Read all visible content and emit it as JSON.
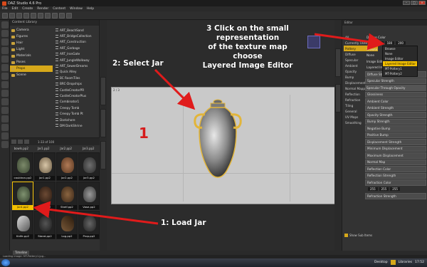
{
  "window": {
    "title": "DAZ Studio 4.6 Pro",
    "controls": [
      "–",
      "□",
      "×"
    ]
  },
  "menu": [
    "File",
    "Edit",
    "Create",
    "Render",
    "Content",
    "Window",
    "Help"
  ],
  "content_library": {
    "header": "Content Library",
    "tree": [
      "Camera",
      "Figures",
      "Hair",
      "Light",
      "Materials",
      "Poses",
      "Props",
      "Scene"
    ],
    "selected": "Props",
    "list": [
      "ART_BeachSand",
      "ART_BridgeCollection",
      "ART_Construction",
      "ART_Garbage",
      "ART_IronGate",
      "ART_JungleWalkway",
      "ART_SewerDreams",
      "Quick Alley",
      "BC RoomTiles",
      "BRC-Dropships",
      "CastleCreatorPR",
      "CastleCreatorPlus",
      "Combinator1",
      "Creepy Tomb",
      "Creepy Tomb Pt",
      "Darkshore",
      "DM DarkShrine"
    ]
  },
  "thumbnails": {
    "count": "1-33 of 100",
    "top_labels": [
      "bowls.pp2",
      "Jar1.pp2",
      "Jar2.pp2",
      "Jar3.pp2"
    ],
    "items": [
      {
        "label": "cauldron.pp2",
        "selected": false
      },
      {
        "label": "Jar1.pp2",
        "selected": false
      },
      {
        "label": "Jar2.pp2",
        "selected": false
      },
      {
        "label": "Jar3.pp2",
        "selected": false
      },
      {
        "label": "Jar4.pp2",
        "selected": true
      },
      {
        "label": "rack.pp2",
        "selected": false
      },
      {
        "label": "Shelf.pp2",
        "selected": false
      },
      {
        "label": "Vase.pp2",
        "selected": false
      },
      {
        "label": "Knife.pp2",
        "selected": false
      },
      {
        "label": "Stand.pp2",
        "selected": false
      },
      {
        "label": "Log.pp2",
        "selected": false
      },
      {
        "label": "Prop.pp2",
        "selected": false
      }
    ],
    "tab": "Files"
  },
  "viewport": {
    "label": "2 / 3",
    "tab": "Timeline"
  },
  "surfaces": {
    "header": "Editor",
    "title": "Pottery",
    "scene_items": [
      "All",
      "Currently Used",
      "Pottery",
      "Diffuse",
      "Specular",
      "Ambient",
      "Opacity",
      "Bump",
      "Displacement",
      "Normal Mapping",
      "Reflection",
      "Refraction",
      "Tiling",
      "General",
      "UV Maps",
      "Smoothing"
    ],
    "selected_item": "Pottery",
    "groups": [
      "Diffuse",
      "Specular",
      "Ambient",
      "Opacity",
      "Bump",
      "Displacement",
      "Normal Mapping"
    ],
    "properties": [
      {
        "label": "Diffuse Color",
        "kind": "header"
      },
      {
        "label": "",
        "kind": "rgb",
        "values": [
          "150",
          "180",
          "200"
        ]
      },
      {
        "label": "Browse",
        "kind": "row"
      },
      {
        "label": "None",
        "kind": "row"
      },
      {
        "label": "Image Editor",
        "kind": "row"
      },
      {
        "label": "Layered Image Editor",
        "kind": "row"
      },
      {
        "label": "Diffuse Strength",
        "kind": "slider"
      },
      {
        "label": "Specular Strength",
        "kind": "slider"
      },
      {
        "label": "Specular Through Opacity",
        "kind": "dropdown"
      },
      {
        "label": "Glossiness",
        "kind": "slider"
      },
      {
        "label": "Ambient Color",
        "kind": "slider"
      },
      {
        "label": "Ambient Strength",
        "kind": "slider"
      },
      {
        "label": "Opacity Strength",
        "kind": "slider"
      },
      {
        "label": "Bump Strength",
        "kind": "slider"
      },
      {
        "label": "Negative Bump",
        "kind": "slider"
      },
      {
        "label": "Positive Bump",
        "kind": "slider"
      },
      {
        "label": "Displacement Strength",
        "kind": "slider"
      },
      {
        "label": "Minimum Displacement",
        "kind": "slider"
      },
      {
        "label": "Maximum Displacement",
        "kind": "slider"
      },
      {
        "label": "Normal Map",
        "kind": "slider"
      },
      {
        "label": "Reflection Color",
        "kind": "slider"
      },
      {
        "label": "Reflection Strength",
        "kind": "slider"
      },
      {
        "label": "Refraction Color",
        "kind": "slider"
      },
      {
        "label": "",
        "kind": "rgb",
        "values": [
          "255",
          "255",
          "255"
        ]
      },
      {
        "label": "Refraction Strength",
        "kind": "slider"
      }
    ],
    "popup": [
      "Browse",
      "None",
      "Image Editor",
      "Layered Image Editor",
      "MT-Pottery1",
      "MT-Pottery2"
    ],
    "popup_highlight": "Layered Image Editor",
    "show_sub_items": "Show Sub Items",
    "tab": "Tiles"
  },
  "status": "Loading image: MT-Pottery1.jpg...",
  "taskbar": {
    "desktop": "Desktop",
    "libraries": "Libraries",
    "time": "17:52"
  },
  "annotations": {
    "step3": [
      "3 Click on the small representation",
      "of the texture map",
      "choose",
      "Layered Image Editor"
    ],
    "step2": "2: Select Jar",
    "step1": "1: Load Jar",
    "marker": "1",
    "arrow_color": "#e01b1b",
    "accent_color": "#d6a81a"
  }
}
